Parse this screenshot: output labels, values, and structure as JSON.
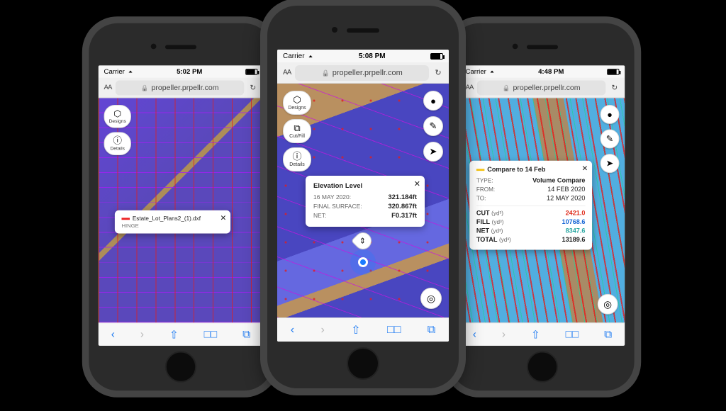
{
  "phones": {
    "left": {
      "status": {
        "carrier": "Carrier",
        "time": "5:02 PM"
      },
      "url": "propeller.prpellr.com",
      "chips": [
        {
          "icon": "⬡",
          "label": "Designs"
        },
        {
          "icon": "ⓘ",
          "label": "Details"
        }
      ],
      "card": {
        "file": "Estate_Lot_Plans2_(1).dxf",
        "kind": "HINGE"
      }
    },
    "center": {
      "status": {
        "carrier": "Carrier",
        "time": "5:08 PM"
      },
      "url": "propeller.prpellr.com",
      "chips": [
        {
          "icon": "⬡",
          "label": "Designs"
        },
        {
          "icon": "⧉",
          "label": "Cut/Fill"
        },
        {
          "icon": "ⓘ",
          "label": "Details"
        }
      ],
      "rbtns": [
        "●",
        "✎",
        "➤"
      ],
      "card": {
        "title": "Elevation Level",
        "rows": [
          {
            "k": "16 MAY 2020:",
            "v": "321.184ft"
          },
          {
            "k": "FINAL SURFACE:",
            "v": "320.867ft"
          },
          {
            "k": "NET:",
            "v": "F0.317ft"
          }
        ]
      }
    },
    "right": {
      "status": {
        "carrier": "Carrier",
        "time": "4:48 PM"
      },
      "url": "propeller.prpellr.com",
      "rbtns": [
        "●",
        "✎",
        "➤"
      ],
      "card": {
        "title": "Compare to 14 Feb",
        "meta": [
          {
            "k": "TYPE:",
            "v": "Volume Compare"
          },
          {
            "k": "FROM:",
            "v": "14 FEB 2020"
          },
          {
            "k": "TO:",
            "v": "12 MAY 2020"
          }
        ],
        "vals": [
          {
            "k": "CUT",
            "u": "(yd³)",
            "v": "2421.0",
            "cls": "val-red"
          },
          {
            "k": "FILL",
            "u": "(yd³)",
            "v": "10768.6",
            "cls": "val-blue"
          },
          {
            "k": "NET",
            "u": "(yd³)",
            "v": "8347.6",
            "cls": "val-teal"
          },
          {
            "k": "TOTAL",
            "u": "(yd³)",
            "v": "13189.6",
            "cls": "val-bold"
          }
        ]
      }
    }
  }
}
